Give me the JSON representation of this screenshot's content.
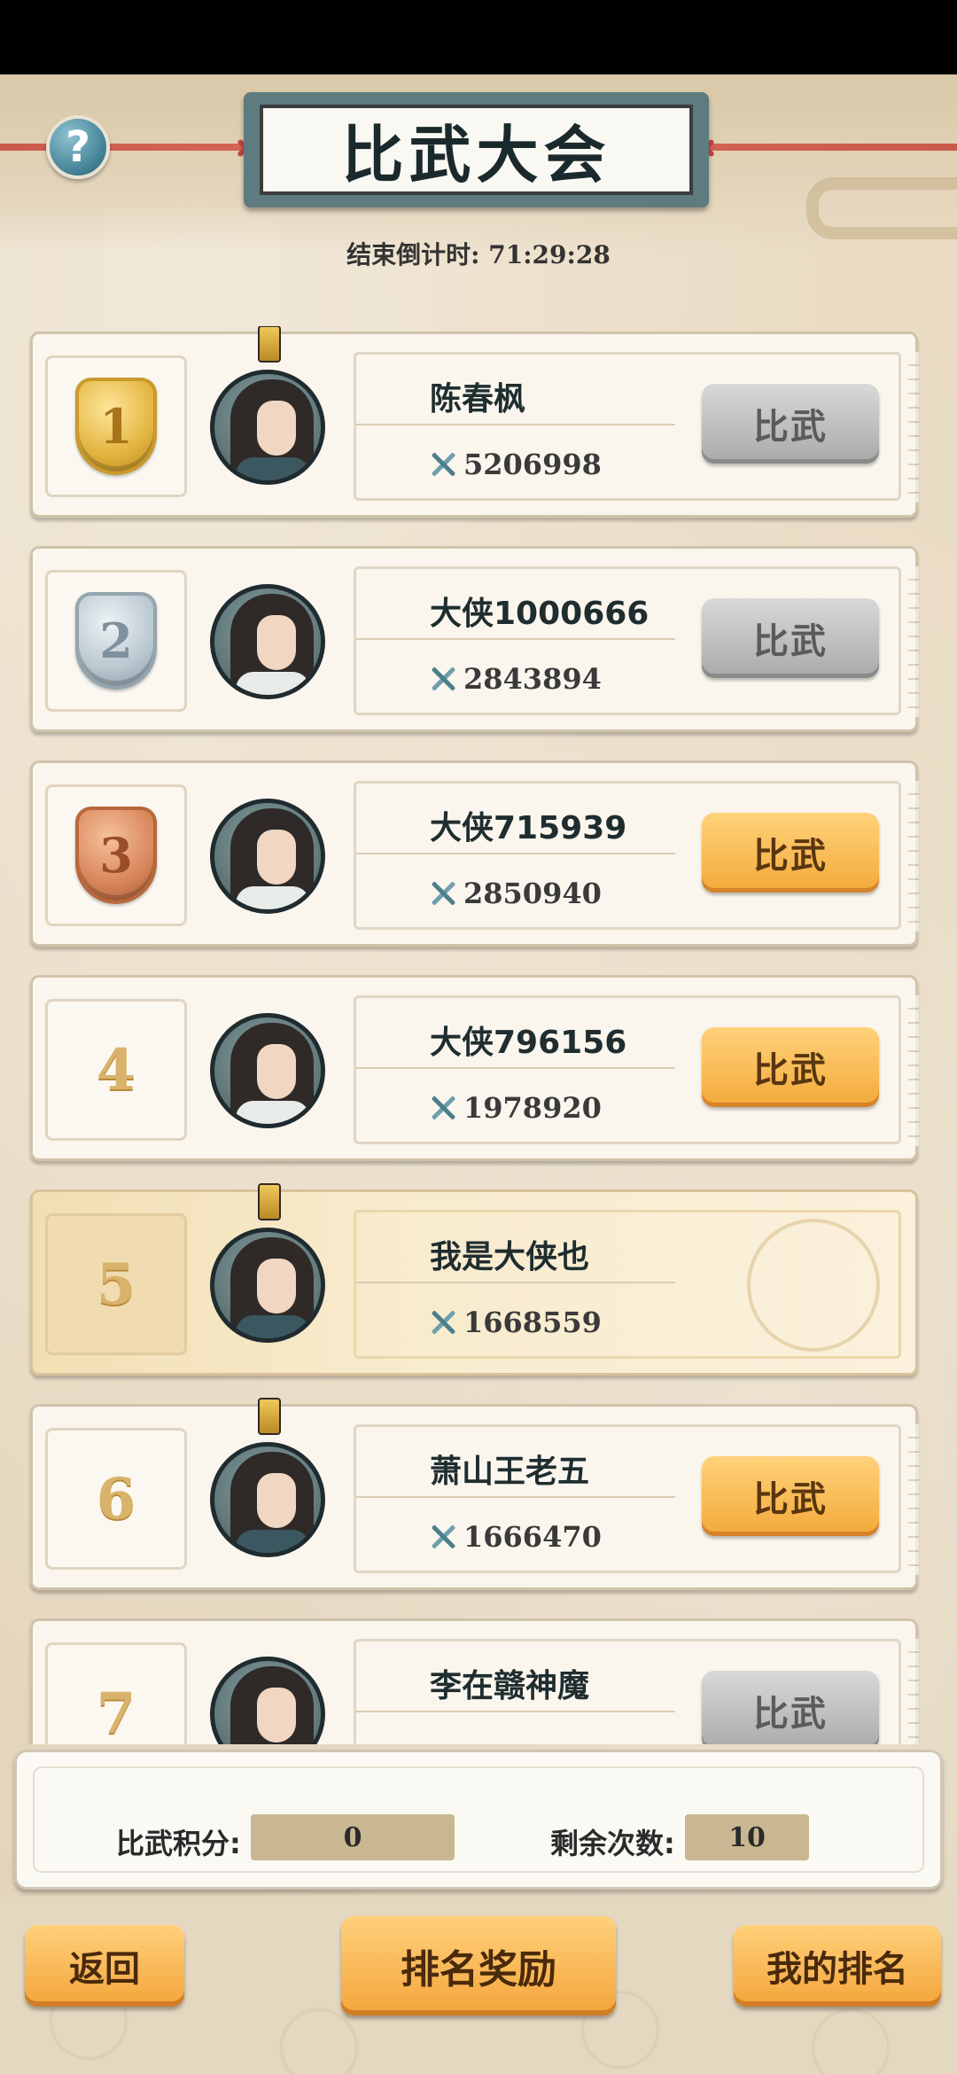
{
  "header": {
    "title": "比武大会",
    "countdown_label": "结束倒计时:",
    "countdown_value": "71:29:28",
    "help_icon": "question-mark-icon"
  },
  "players": [
    {
      "rank": "1",
      "medal": "gold",
      "name": "陈春枫",
      "power": "5206998",
      "button": "比武",
      "button_state": "disabled"
    },
    {
      "rank": "2",
      "medal": "silver",
      "name": "大侠1000666",
      "power": "2843894",
      "button": "比武",
      "button_state": "disabled"
    },
    {
      "rank": "3",
      "medal": "bronze",
      "name": "大侠715939",
      "power": "2850940",
      "button": "比武",
      "button_state": "enabled"
    },
    {
      "rank": "4",
      "medal": "none",
      "name": "大侠796156",
      "power": "1978920",
      "button": "比武",
      "button_state": "enabled"
    },
    {
      "rank": "5",
      "medal": "none",
      "name": "我是大侠也",
      "power": "1668559",
      "button": "",
      "button_state": "self"
    },
    {
      "rank": "6",
      "medal": "none",
      "name": "萧山王老五",
      "power": "1666470",
      "button": "比武",
      "button_state": "enabled"
    },
    {
      "rank": "7",
      "medal": "none",
      "name": "李在赣神魔",
      "power": "",
      "button": "比武",
      "button_state": "disabled"
    }
  ],
  "score": {
    "points_label": "比武积分:",
    "points_value": "0",
    "remaining_label": "剩余次数:",
    "remaining_value": "10"
  },
  "footer": {
    "back": "返回",
    "rank_rewards": "排名奖励",
    "my_rank": "我的排名"
  },
  "colors": {
    "background": "#e9dcc6",
    "button_active": "#f3a93a",
    "button_disabled": "#a9a9a9",
    "title_frame": "#5e7b80",
    "rope": "#c7443b"
  }
}
